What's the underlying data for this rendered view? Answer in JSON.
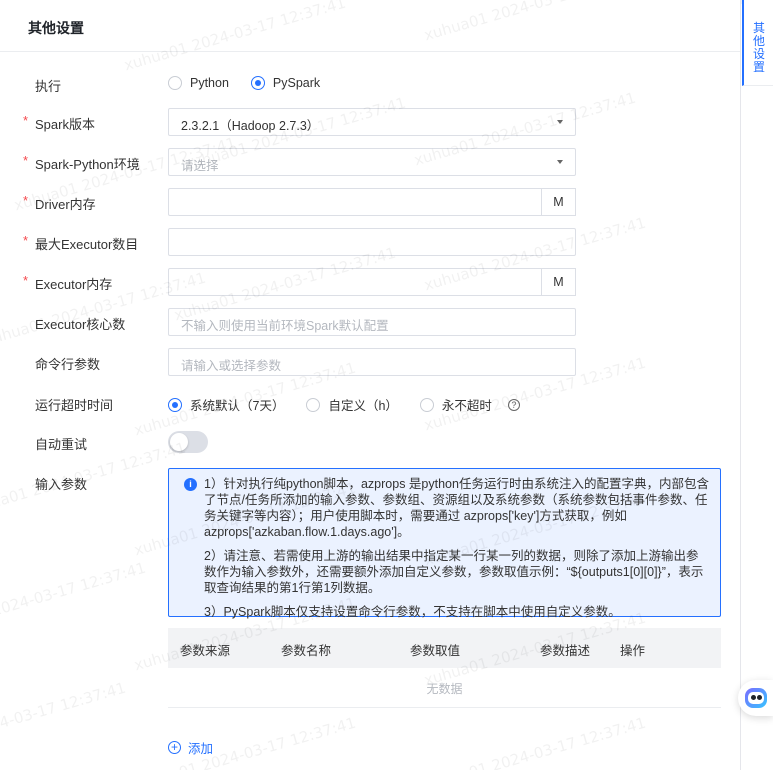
{
  "panel": {
    "title": "其他设置"
  },
  "side_nav": {
    "active_tab": "其他设置"
  },
  "form": {
    "execute": {
      "label": "执行",
      "options": [
        "Python",
        "PySpark"
      ],
      "selected": "PySpark"
    },
    "spark_version": {
      "label": "Spark版本",
      "value": "2.3.2.1（Hadoop 2.7.3）"
    },
    "spark_python_env": {
      "label": "Spark-Python环境",
      "placeholder": "请选择"
    },
    "driver_memory": {
      "label": "Driver内存",
      "value": "",
      "unit": "M"
    },
    "max_executor": {
      "label": "最大Executor数目",
      "value": ""
    },
    "executor_memory": {
      "label": "Executor内存",
      "value": "",
      "unit": "M"
    },
    "executor_cores": {
      "label": "Executor核心数",
      "placeholder": "不输入则使用当前环境Spark默认配置"
    },
    "cli_params": {
      "label": "命令行参数",
      "placeholder": "请输入或选择参数"
    },
    "timeout": {
      "label": "运行超时时间",
      "options": [
        "系统默认（7天）",
        "自定义（h）",
        "永不超时"
      ],
      "selected": "系统默认（7天）",
      "help_icon": "?"
    },
    "auto_retry": {
      "label": "自动重试",
      "enabled": false
    },
    "input_params": {
      "label": "输入参数"
    }
  },
  "notice": {
    "icon": "i",
    "paragraphs": [
      "1）针对执行纯python脚本，azprops 是python任务运行时由系统注入的配置字典，内部包含了节点/任务所添加的输入参数、参数组、资源组以及系统参数（系统参数包括事件参数、任务关键字等内容）；用户使用脚本时，需要通过 azprops['key']方式获取，例如azprops['azkaban.flow.1.days.ago']。",
      "2）请注意、若需使用上游的输出结果中指定某一行某一列的数据，则除了添加上游输出参数作为输入参数外，还需要额外添加自定义参数，参数取值示例：“${outputs1[0][0]}”，表示取查询结果的第1行第1列数据。",
      "3）PySpark脚本仅支持设置命令行参数，不支持在脚本中使用自定义参数。"
    ]
  },
  "table": {
    "columns": [
      "参数来源",
      "参数名称",
      "参数取值",
      "参数描述",
      "操作"
    ],
    "rows": [],
    "empty_text": "无数据"
  },
  "add_button": {
    "icon": "+",
    "label": "添加"
  },
  "required_mark": "*",
  "watermark": "xuhua01 2024-03-17 12:37:41",
  "colors": {
    "accent": "#2470ff",
    "required": "#f5484c",
    "notice_bg": "#ebf2ff"
  }
}
